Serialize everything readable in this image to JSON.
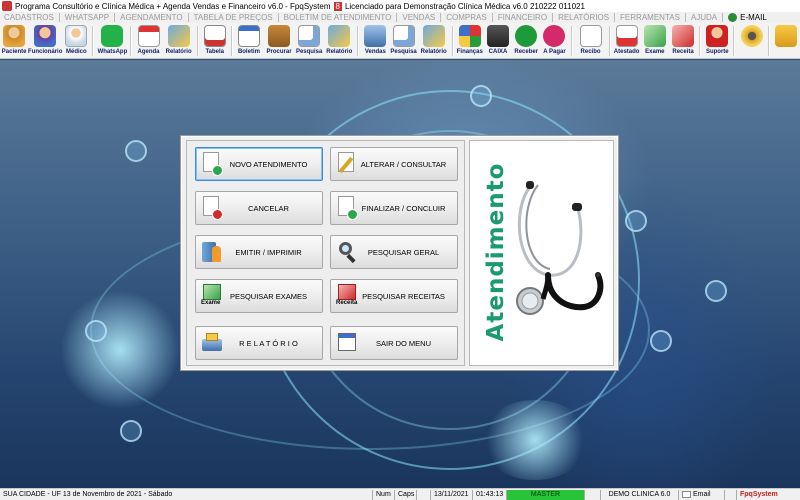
{
  "window": {
    "title": "Programa Consultório e Clínica Médica + Agenda Vendas e Financeiro v6.0 - FpqSystem",
    "license": "Licenciado para  Demonstração Clínica Médica v6.0 210222 011021",
    "badge": "8"
  },
  "menu": [
    "CADASTROS",
    "WHATSAPP",
    "AGENDAMENTO",
    "TABELA DE PREÇOS",
    "BOLETIM DE ATENDIMENTO",
    "VENDAS",
    "COMPRAS",
    "FINANCEIRO",
    "RELATÓRIOS",
    "FERRAMENTAS",
    "AJUDA"
  ],
  "menu_email": "E-MAIL",
  "toolbar": {
    "paciente": "Paciente",
    "funcionario": "Funcionário",
    "medico": "Médico",
    "whatsapp": "WhatsApp",
    "agenda": "Agenda",
    "relatorio1": "Relatório",
    "tabela": "Tabela",
    "boletim": "Boletim",
    "procurar": "Procurar",
    "pesquisa1": "Pesquisa",
    "relatorio2": "Relatório",
    "vendas": "Vendas",
    "pesquisa2": "Pesquisa",
    "relatorio3": "Relatório",
    "financas": "Finanças",
    "caixa": "CAIXA",
    "receber": "Receber",
    "apagar": "A Pagar",
    "recibo": "Recibo",
    "atestado": "Atestado",
    "exame": "Exame",
    "receita": "Receita",
    "suporte": "Suporte"
  },
  "panel": {
    "side_title": "Atendimento",
    "buttons": {
      "novo": "NOVO ATENDIMENTO",
      "alterar": "ALTERAR  /  CONSULTAR",
      "cancelar": "CANCELAR",
      "finalizar": "FINALIZAR  /  CONCLUIR",
      "emitir": "EMITIR  /  IMPRIMIR",
      "pesquisar_geral": "PESQUISAR GERAL",
      "pesquisar_exames": "PESQUISAR EXAMES",
      "pesquisar_receitas": "PESQUISAR RECEITAS",
      "relatorio": "R E L A T Ó R I O",
      "sair": "SAIR DO MENU"
    },
    "icon_labels": {
      "exame": "Exame",
      "receita": "Receita"
    }
  },
  "status": {
    "city": "SUA CIDADE - UF 13 de Novembro de 2021 - Sábado",
    "num": "Num",
    "caps": "Caps",
    "date": "13/11/2021",
    "time": "01:43:13",
    "user": "MASTER",
    "company": "DEMO CLINICA 6.0",
    "email": "Email",
    "brand": "FpqSystem"
  },
  "colors": {
    "accent_title": "#1b9a6e",
    "status_master": "#27c43a",
    "brand": "#c62020"
  }
}
